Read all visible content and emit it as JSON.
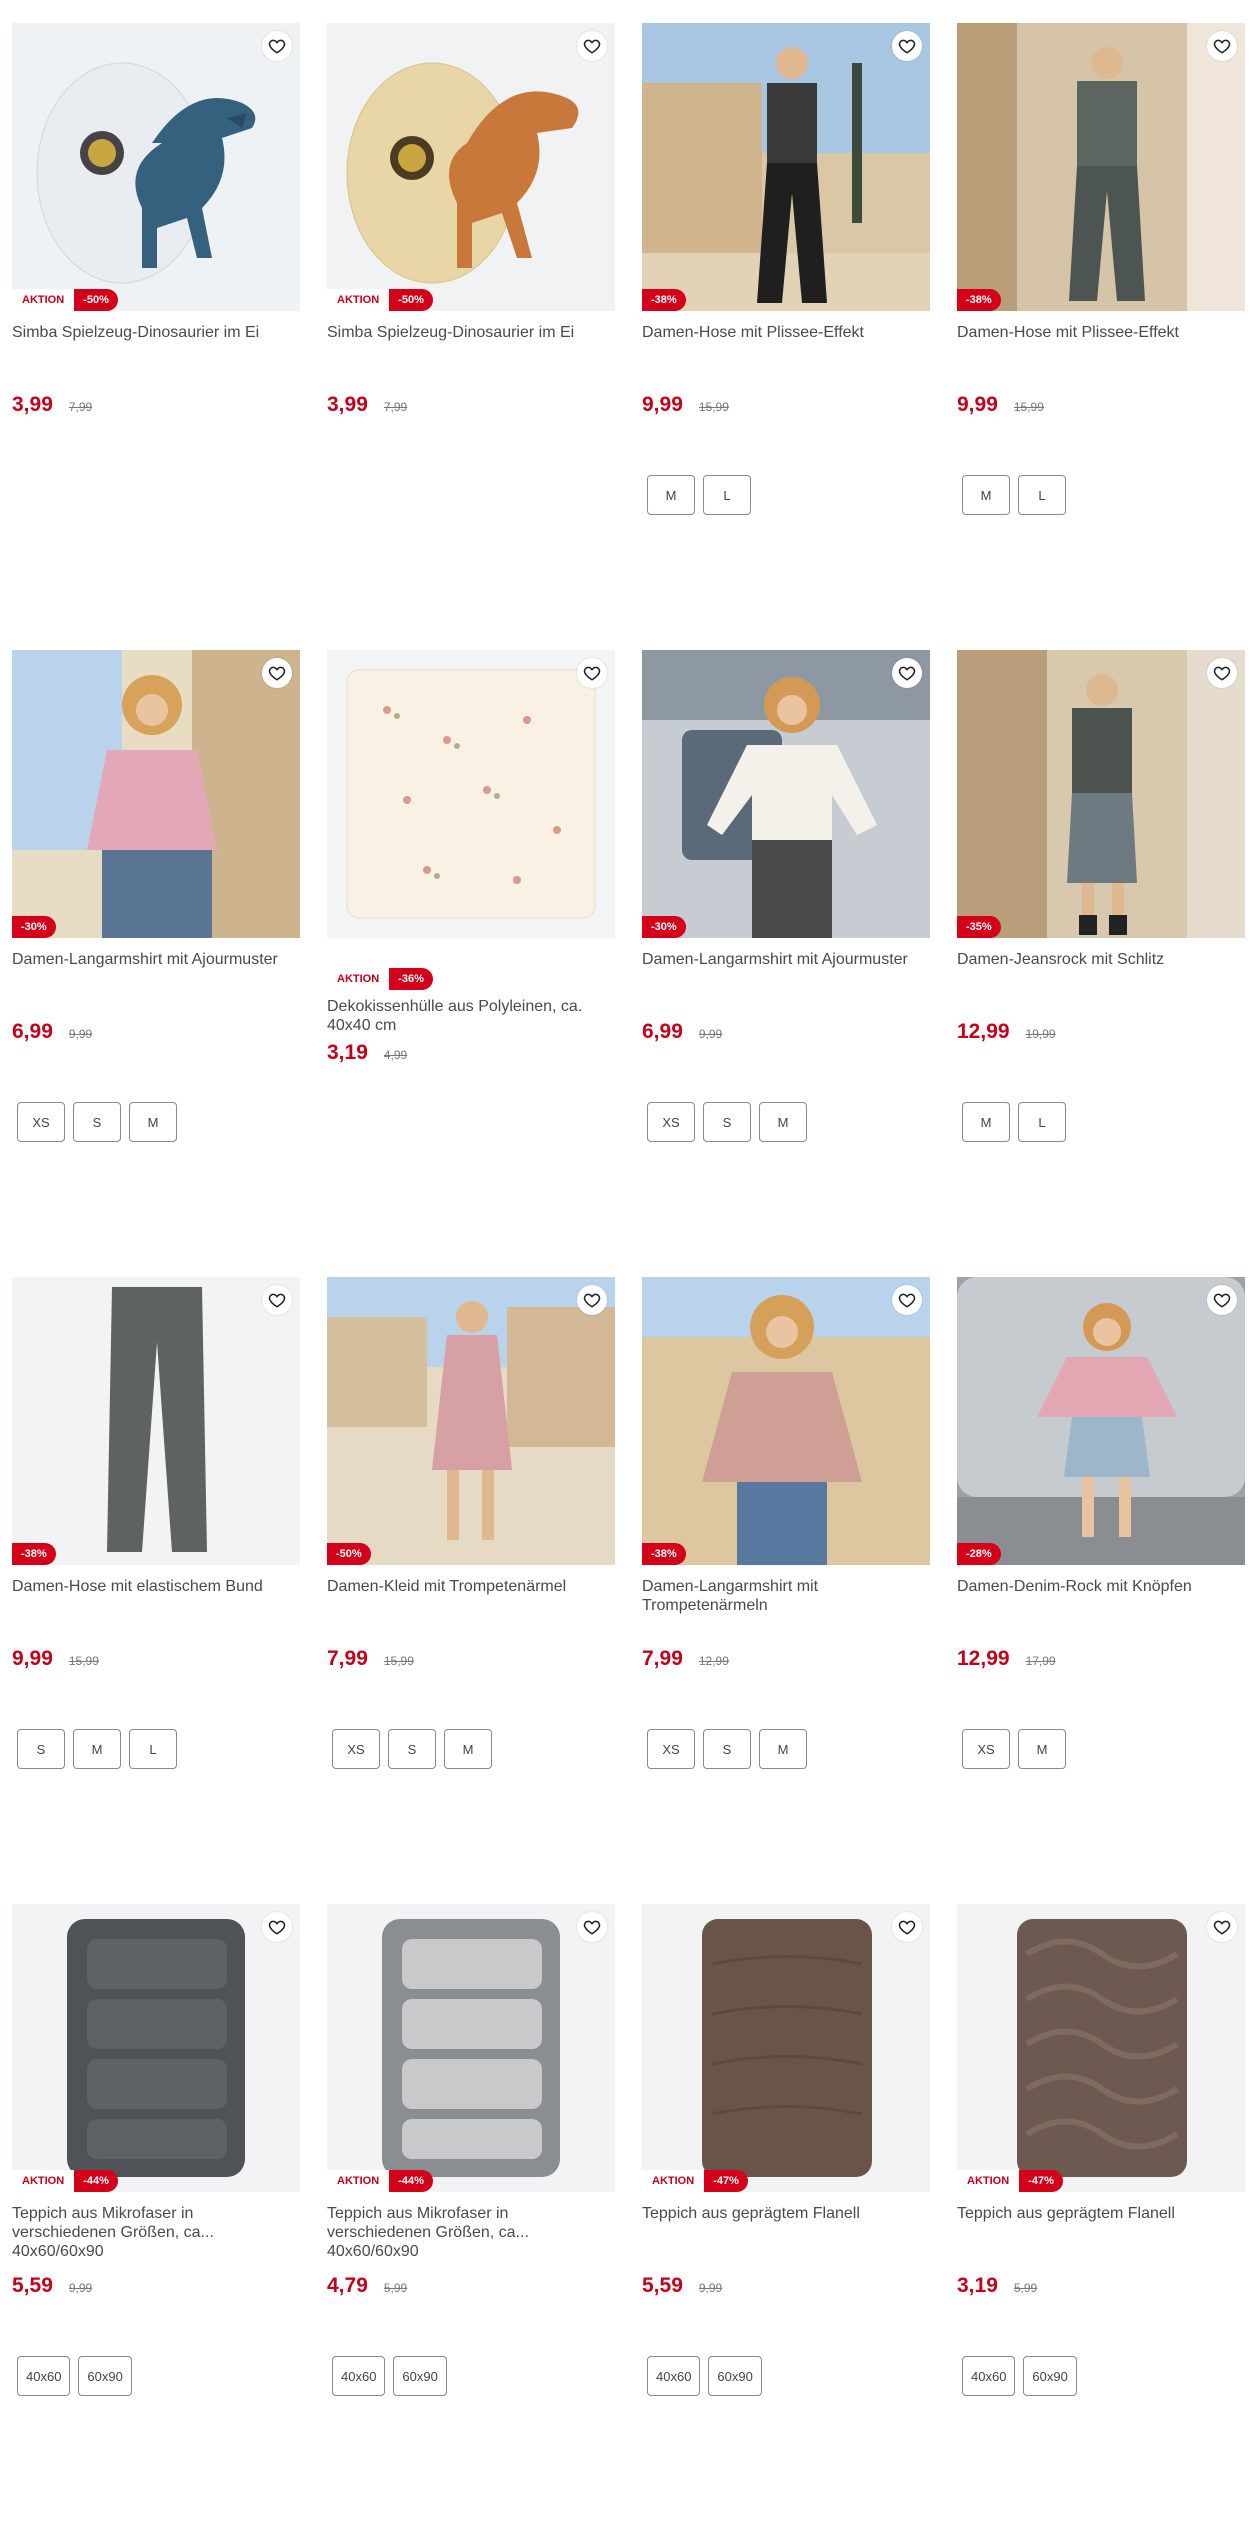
{
  "products": [
    {
      "title": "Simba Spielzeug-Dinosaurier im Ei",
      "price": "3,99",
      "old_price": "7,99",
      "discount": "-50%",
      "aktion": "AKTION",
      "sizes": [],
      "image": "dino-blue-egg"
    },
    {
      "title": "Simba Spielzeug-Dinosaurier im Ei",
      "price": "3,99",
      "old_price": "7,99",
      "discount": "-50%",
      "aktion": "AKTION",
      "sizes": [],
      "image": "dino-orange-egg"
    },
    {
      "title": "Damen-Hose mit Plissee-Effekt",
      "price": "9,99",
      "old_price": "15,99",
      "discount": "-38%",
      "aktion": "",
      "sizes": [
        "M",
        "L"
      ],
      "image": "woman-black-trousers"
    },
    {
      "title": "Damen-Hose mit Plissee-Effekt",
      "price": "9,99",
      "old_price": "15,99",
      "discount": "-38%",
      "aktion": "",
      "sizes": [
        "M",
        "L"
      ],
      "image": "woman-grey-trousers"
    },
    {
      "title": "Damen-Langarmshirt mit Ajourmuster",
      "price": "6,99",
      "old_price": "9,99",
      "discount": "-30%",
      "aktion": "",
      "sizes": [
        "XS",
        "S",
        "M"
      ],
      "image": "woman-pink-top"
    },
    {
      "title": "Dekokissenhülle aus Polyleinen, ca. 40x40 cm",
      "price": "3,19",
      "old_price": "4,99",
      "discount": "-36%",
      "aktion": "AKTION",
      "sizes": [],
      "image": "floral-cushion",
      "badge_below": true
    },
    {
      "title": "Damen-Langarmshirt mit Ajourmuster",
      "price": "6,99",
      "old_price": "9,99",
      "discount": "-30%",
      "aktion": "",
      "sizes": [
        "XS",
        "S",
        "M"
      ],
      "image": "woman-white-top"
    },
    {
      "title": "Damen-Jeansrock mit Schlitz",
      "price": "12,99",
      "old_price": "19,99",
      "discount": "-35%",
      "aktion": "",
      "sizes": [
        "M",
        "L"
      ],
      "image": "woman-denim-skirt"
    },
    {
      "title": "Damen-Hose mit elastischem Bund",
      "price": "9,99",
      "old_price": "15,99",
      "discount": "-38%",
      "aktion": "",
      "sizes": [
        "S",
        "M",
        "L"
      ],
      "image": "grey-trousers"
    },
    {
      "title": "Damen-Kleid mit Trompetenärmel",
      "price": "7,99",
      "old_price": "15,99",
      "discount": "-50%",
      "aktion": "",
      "sizes": [
        "XS",
        "S",
        "M"
      ],
      "image": "woman-pink-dress"
    },
    {
      "title": "Damen-Langarmshirt mit Trompetenärmeln",
      "price": "7,99",
      "old_price": "12,99",
      "discount": "-38%",
      "aktion": "",
      "sizes": [
        "XS",
        "S",
        "M"
      ],
      "image": "woman-floral-top"
    },
    {
      "title": "Damen-Denim-Rock mit Knöpfen",
      "price": "12,99",
      "old_price": "17,99",
      "discount": "-28%",
      "aktion": "",
      "sizes": [
        "XS",
        "M"
      ],
      "image": "woman-denim-mini"
    },
    {
      "title": "Teppich aus Mikrofaser in verschiedenen Größen, ca... 40x60/60x90",
      "price": "5,59",
      "old_price": "9,99",
      "discount": "-44%",
      "aktion": "AKTION",
      "sizes": [
        "40x60",
        "60x90"
      ],
      "image": "bath-mat-dark"
    },
    {
      "title": "Teppich aus Mikrofaser in verschiedenen Größen, ca... 40x60/60x90",
      "price": "4,79",
      "old_price": "5,99",
      "discount": "-44%",
      "aktion": "AKTION",
      "sizes": [
        "40x60",
        "60x90"
      ],
      "image": "bath-mat-grey"
    },
    {
      "title": "Teppich aus geprägtem Flanell",
      "price": "5,59",
      "old_price": "9,99",
      "discount": "-47%",
      "aktion": "AKTION",
      "sizes": [
        "40x60",
        "60x90"
      ],
      "image": "flannel-mat-brown"
    },
    {
      "title": "Teppich aus geprägtem Flanell",
      "price": "3,19",
      "old_price": "5,99",
      "discount": "-47%",
      "aktion": "AKTION",
      "sizes": [
        "40x60",
        "60x90"
      ],
      "image": "flannel-mat-wave"
    }
  ],
  "colors": {
    "accent": "#c3001a",
    "badge": "#d4001a"
  },
  "icons": {
    "favorite": "heart-icon"
  }
}
